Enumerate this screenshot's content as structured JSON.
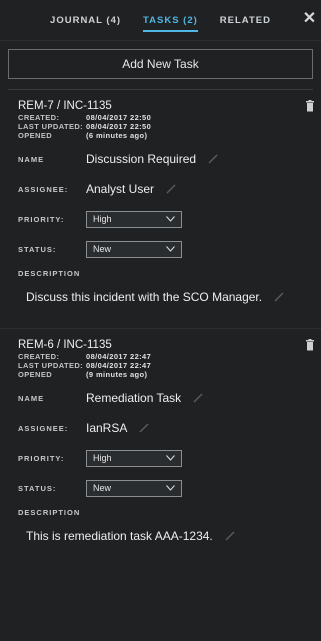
{
  "tabs": [
    {
      "label": "JOURNAL (4)"
    },
    {
      "label": "TASKS (2)"
    },
    {
      "label": "RELATED"
    }
  ],
  "close_icon": "close-icon",
  "add_button": "Add New Task",
  "labels": {
    "created": "CREATED:",
    "last_updated": "LAST UPDATED:",
    "opened": "OPENED",
    "name": "NAME",
    "assignee": "ASSIGNEE:",
    "priority": "PRIORITY:",
    "status": "STATUS:",
    "description": "DESCRIPTION"
  },
  "tasks": [
    {
      "id": "REM-7 / INC-1135",
      "created": "08/04/2017 22:50",
      "last_updated": "08/04/2017 22:50",
      "opened": "(6 minutes ago)",
      "name": "Discussion Required",
      "assignee": "Analyst User",
      "priority": "High",
      "status": "New",
      "description": "Discuss this incident with the SCO Manager."
    },
    {
      "id": "REM-6 / INC-1135",
      "created": "08/04/2017 22:47",
      "last_updated": "08/04/2017 22:47",
      "opened": "(9 minutes ago)",
      "name": "Remediation Task",
      "assignee": "IanRSA",
      "priority": "High",
      "status": "New",
      "description": "This is remediation task AAA-1234."
    }
  ]
}
